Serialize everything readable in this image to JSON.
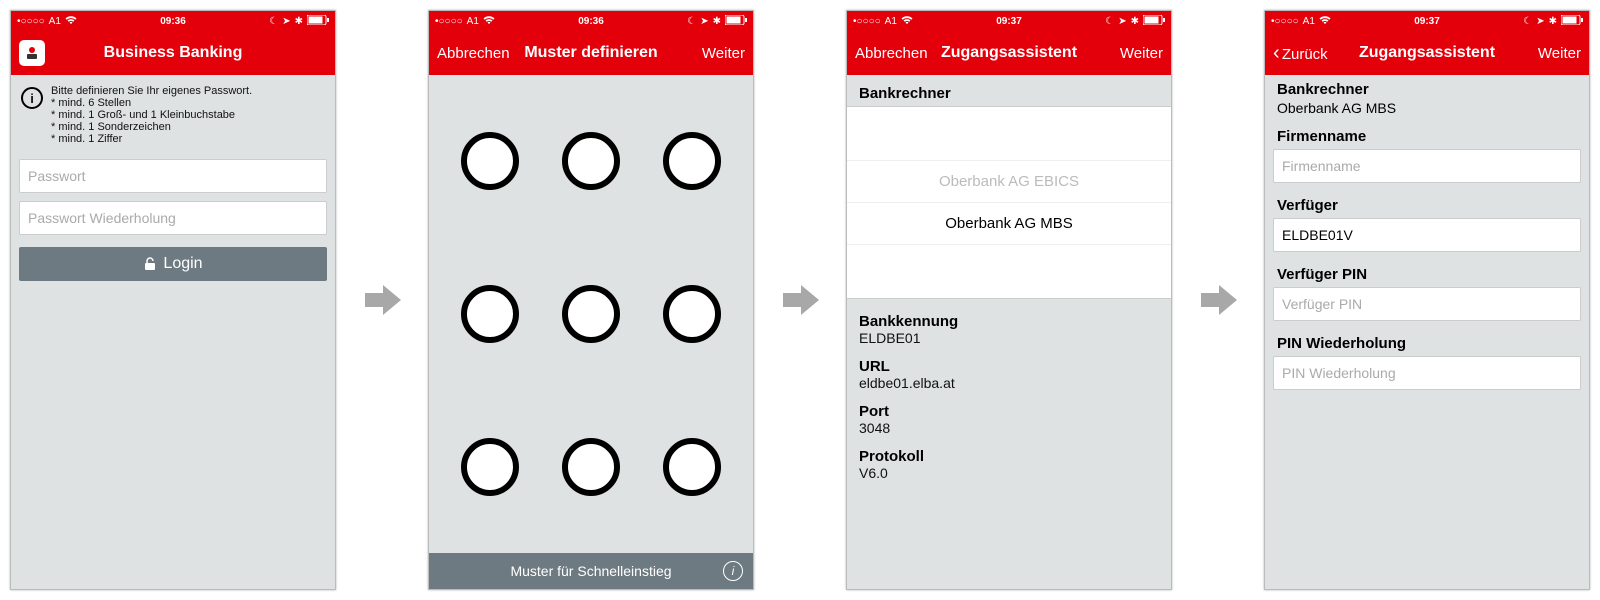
{
  "colors": {
    "brand": "#E3000B",
    "muted": "#6d7a81"
  },
  "status": {
    "carrier": "A1",
    "time1": "09:36",
    "time2": "09:36",
    "time3": "09:37",
    "time4": "09:37",
    "signal": "•○○○○"
  },
  "screen1": {
    "title": "Business Banking",
    "info": "Bitte definieren Sie Ihr eigenes Passwort.\n* mind. 6 Stellen\n* mind. 1 Groß- und 1 Kleinbuchstabe\n* mind. 1 Sonderzeichen\n* mind. 1 Ziffer",
    "password_placeholder": "Passwort",
    "password_repeat_placeholder": "Passwort Wiederholung",
    "login_label": "Login"
  },
  "screen2": {
    "left": "Abbrechen",
    "title": "Muster definieren",
    "right": "Weiter",
    "footer": "Muster für Schnelleinstieg"
  },
  "screen3": {
    "left": "Abbrechen",
    "title": "Zugangsassistent",
    "right": "Weiter",
    "bank_label": "Bankrechner",
    "options": [
      "Oberbank AG EBICS",
      "Oberbank AG MBS"
    ],
    "bankkennung_label": "Bankkennung",
    "bankkennung_value": "ELDBE01",
    "url_label": "URL",
    "url_value": "eldbe01.elba.at",
    "port_label": "Port",
    "port_value": "3048",
    "protokoll_label": "Protokoll",
    "protokoll_value": "V6.0"
  },
  "screen4": {
    "left": "Zurück",
    "title": "Zugangsassistent",
    "right": "Weiter",
    "bank_label": "Bankrechner",
    "bank_value": "Oberbank AG MBS",
    "firmenname_label": "Firmenname",
    "firmenname_placeholder": "Firmenname",
    "verfueger_label": "Verfüger",
    "verfueger_value": "ELDBE01V",
    "pin_label": "Verfüger PIN",
    "pin_placeholder": "Verfüger PIN",
    "pin2_label": "PIN Wiederholung",
    "pin2_placeholder": "PIN Wiederholung"
  }
}
